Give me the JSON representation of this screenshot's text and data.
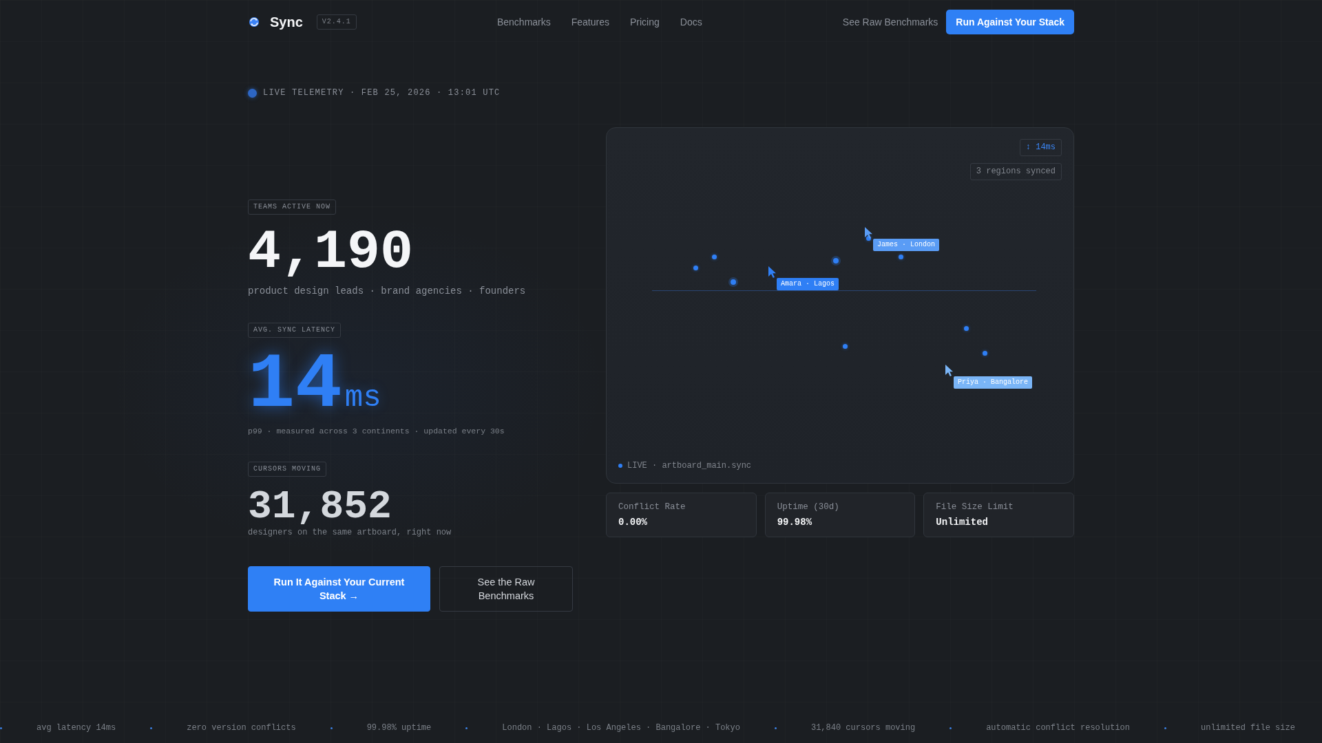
{
  "nav": {
    "brand": "Sync",
    "version": "V2.4.1",
    "links": [
      "Benchmarks",
      "Features",
      "Pricing",
      "Docs"
    ],
    "secondary_link": "See Raw Benchmarks",
    "cta": "Run Against Your Stack"
  },
  "telemetry": "LIVE TELEMETRY · FEB 25, 2026 · 13:01 UTC",
  "metrics": [
    {
      "kind": "hero",
      "badge": "TEAMS ACTIVE NOW",
      "value": "4,190",
      "caption": "product design leads · brand agencies · founders"
    },
    {
      "kind": "latency",
      "badge": "AVG. SYNC LATENCY",
      "value": "14",
      "unit": "ms",
      "caption": "p99 · measured across 3 continents · updated every 30s"
    },
    {
      "kind": "count",
      "badge": "CURSORS MOVING",
      "value": "31,852",
      "caption": "designers on the same artboard, right now"
    }
  ],
  "actions": [
    {
      "kind": "primary",
      "label": "Run It Against Your Current Stack →"
    },
    {
      "kind": "secondary",
      "label": "See the Raw Benchmarks"
    }
  ],
  "artboard": {
    "latency_badge": "↕ 14ms",
    "regions_badge": "3 regions synced",
    "cursors": [
      {
        "label": "Amara · Lagos",
        "color": "#2f7ff5"
      },
      {
        "label": "James · London",
        "color": "#5a9cf5"
      },
      {
        "label": "Priya · Bangalore",
        "color": "#7ab5f7"
      }
    ],
    "footer": "LIVE · artboard_main.sync"
  },
  "stats": [
    {
      "label": "Conflict Rate",
      "value": "0.00%"
    },
    {
      "label": "Uptime (30d)",
      "value": "99.98%"
    },
    {
      "label": "File Size Limit",
      "value": "Unlimited"
    }
  ],
  "ticker": [
    "avg latency 14ms",
    "zero version conflicts",
    "99.98% uptime",
    "London · Lagos · Los Angeles · Bangalore · Tokyo",
    "31,840 cursors moving",
    "automatic conflict resolution",
    "unlimited file size"
  ]
}
